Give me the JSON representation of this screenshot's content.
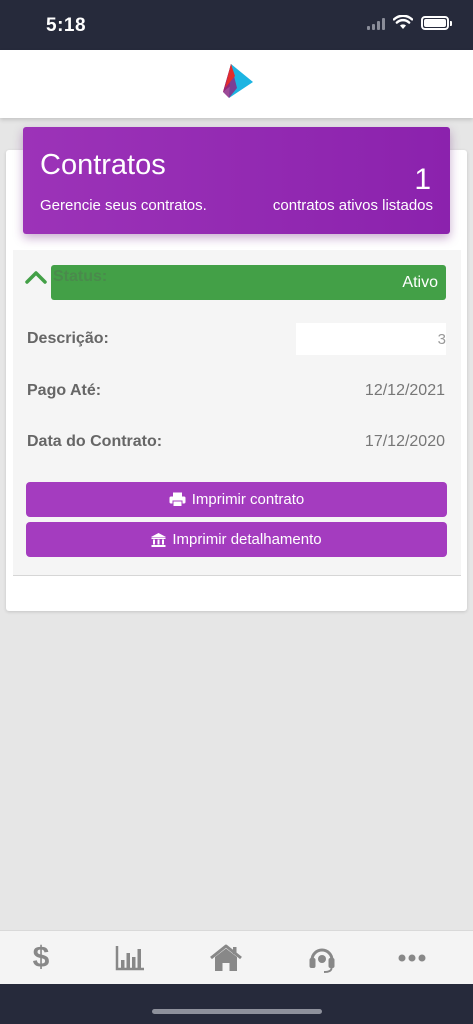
{
  "status_bar": {
    "time": "5:18"
  },
  "header_panel": {
    "title": "Contratos",
    "subtitle": "Gerencie seus contratos.",
    "count": "1",
    "count_label": "contratos ativos listados"
  },
  "contract": {
    "status_label": "Status:",
    "status_value": "Ativo",
    "description_label": "Descrição:",
    "description_value_tail": "3",
    "paid_until_label": "Pago Até:",
    "paid_until_value": "12/12/2021",
    "contract_date_label": "Data do Contrato:",
    "contract_date_value": "17/12/2020",
    "print_contract_label": "Imprimir contrato",
    "print_detail_label": "Imprimir detalhamento"
  },
  "tabs": [
    {
      "icon": "dollar-icon",
      "glyph": "$"
    },
    {
      "icon": "bar-chart-icon"
    },
    {
      "icon": "home-icon"
    },
    {
      "icon": "headset-icon"
    },
    {
      "icon": "more-icon"
    }
  ],
  "colors": {
    "accent_purple": "#a43cbf",
    "status_green": "#43a047",
    "status_bar_bg": "#262a3b"
  }
}
